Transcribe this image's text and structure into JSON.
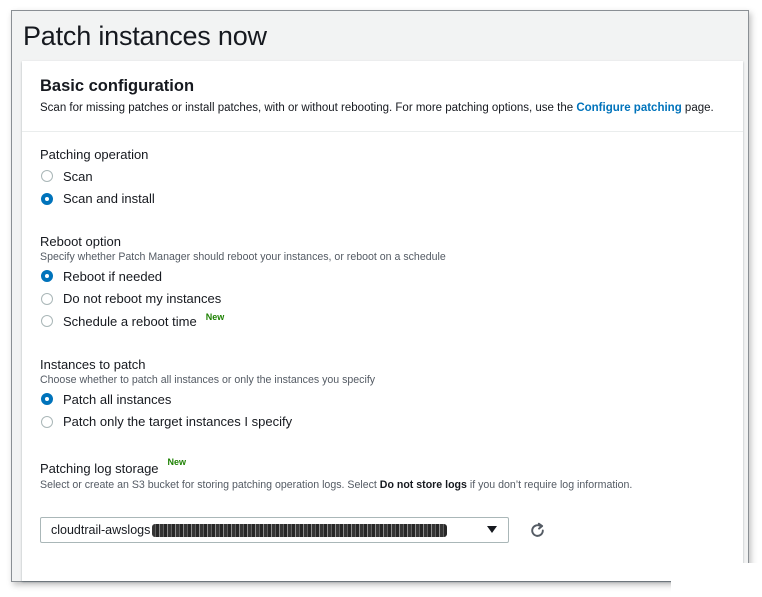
{
  "page": {
    "title": "Patch instances now"
  },
  "basic_configuration": {
    "title": "Basic configuration",
    "description_before": "Scan for missing patches or install patches, with or without rebooting. For more patching options, use the ",
    "description_link": "Configure patching",
    "description_after": " page."
  },
  "patching_operation": {
    "label": "Patching operation",
    "options": [
      "Scan",
      "Scan and install"
    ],
    "selected": "Scan and install"
  },
  "reboot_option": {
    "label": "Reboot option",
    "description": "Specify whether Patch Manager should reboot your instances, or reboot on a schedule",
    "options": [
      "Reboot if needed",
      "Do not reboot my instances",
      "Schedule a reboot time"
    ],
    "new_badge": "New",
    "selected": "Reboot if needed"
  },
  "instances_to_patch": {
    "label": "Instances to patch",
    "description": "Choose whether to patch all instances or only the instances you specify",
    "options": [
      "Patch all instances",
      "Patch only the target instances I specify"
    ],
    "selected": "Patch all instances"
  },
  "log_storage": {
    "label": "Patching log storage",
    "new_badge": "New",
    "description_before": "Select or create an S3 bucket for storing patching operation logs. Select ",
    "description_bold": "Do not store logs",
    "description_after": " if you don’t require log information.",
    "selected_value": "cloudtrail-awslogs"
  },
  "icons": {
    "dropdown": "caret-down-icon",
    "refresh": "refresh-icon"
  },
  "colors": {
    "accent": "#0073bb",
    "new_badge": "#1d8102",
    "text": "#16191f",
    "secondary_text": "#545b64"
  }
}
